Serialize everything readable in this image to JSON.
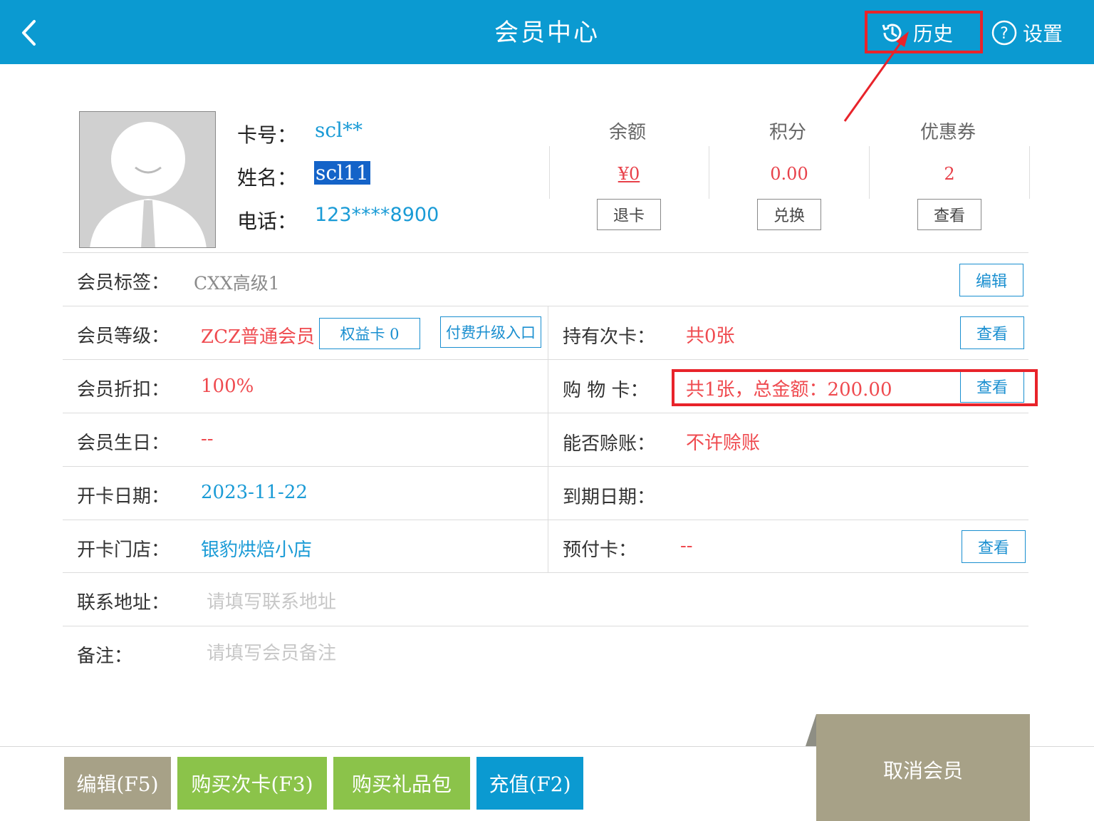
{
  "header": {
    "title": "会员中心",
    "history_label": "历史",
    "settings_label": "设置"
  },
  "member": {
    "card_label": "卡号：",
    "card_value": "scl**",
    "name_label": "姓名：",
    "name_value": "scl11",
    "phone_label": "电话：",
    "phone_value": "123****8900"
  },
  "stats": {
    "balance": {
      "label": "余额",
      "value": "¥0",
      "button": "退卡"
    },
    "points": {
      "label": "积分",
      "value": "0.00",
      "button": "兑换"
    },
    "coupons": {
      "label": "优惠券",
      "value": "2",
      "button": "查看"
    }
  },
  "rows": {
    "tag": {
      "label": "会员标签：",
      "value": "CXX高级1",
      "button": "编辑"
    },
    "level": {
      "label": "会员等级：",
      "value": "ZCZ普通会员",
      "rights_button": "权益卡 0",
      "upgrade_button": "付费升级入口"
    },
    "times_card": {
      "label": "持有次卡：",
      "value": "共0张",
      "button": "查看"
    },
    "discount": {
      "label": "会员折扣：",
      "value": "100%"
    },
    "shopping_card": {
      "label": "购 物 卡：",
      "value": "共1张，总金额：200.00",
      "button": "查看"
    },
    "birthday": {
      "label": "会员生日：",
      "value": "--"
    },
    "credit": {
      "label": "能否赊账：",
      "value": "不许赊账"
    },
    "open_date": {
      "label": "开卡日期：",
      "value": "2023-11-22"
    },
    "expire_date": {
      "label": "到期日期：",
      "value": ""
    },
    "store": {
      "label": "开卡门店：",
      "value": "银豹烘焙小店"
    },
    "prepaid": {
      "label": "预付卡：",
      "value": "--",
      "button": "查看"
    },
    "address": {
      "label": "联系地址：",
      "placeholder": "请填写联系地址"
    },
    "remark": {
      "label": "备注：",
      "placeholder": "请填写会员备注"
    }
  },
  "actions": {
    "edit": "编辑(F5)",
    "buy_times_card": "购买次卡(F3)",
    "buy_gift": "购买礼品包",
    "recharge": "充值(F2)",
    "cancel_member": "取消会员"
  },
  "colors": {
    "header": "#0b9ad1",
    "accent_blue": "#1a9bd6",
    "accent_red": "#ef4a4f",
    "green": "#8bc34a",
    "khaki": "#a7a187",
    "highlight": "#e8232a"
  }
}
